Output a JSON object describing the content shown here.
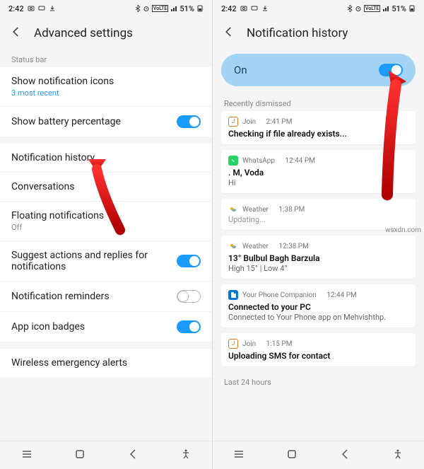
{
  "statusBar": {
    "time": "2:42",
    "battery": "51%",
    "netLabel": "VoLTE"
  },
  "left": {
    "title": "Advanced settings",
    "sectionStatusBar": "Status bar",
    "showNotifIcons": {
      "label": "Show notification icons",
      "sub": "3 most recent"
    },
    "showBattery": {
      "label": "Show battery percentage"
    },
    "notifHistory": "Notification history",
    "conversations": "Conversations",
    "floating": {
      "label": "Floating notifications",
      "sub": "Off"
    },
    "suggest": {
      "label": "Suggest actions and replies for notifications"
    },
    "reminders": "Notification reminders",
    "appIconBadges": "App icon badges",
    "wireless": "Wireless emergency alerts"
  },
  "right": {
    "title": "Notification history",
    "onLabel": "On",
    "recently": "Recently dismissed",
    "last24": "Last 24 hours",
    "items": [
      {
        "app": "Join",
        "time": "2:41 PM",
        "title": "Checking if file already exists...",
        "body": ""
      },
      {
        "app": "WhatsApp",
        "time": "12:44 PM",
        "title": ". M, Voda",
        "body": "Hi"
      },
      {
        "app": "Weather",
        "time": "1:38 PM",
        "title": "Updating...",
        "body": ""
      },
      {
        "app": "Weather",
        "time": "12:38 PM",
        "title": "13° Bulbul Bagh Barzula",
        "body": "High 15° | Low 4°"
      },
      {
        "app": "Your Phone Companion",
        "time": "12:44 PM",
        "title": "Connected to your PC",
        "body": "Connected to Your Phone app on Mehvishthp."
      },
      {
        "app": "Join",
        "time": "1:15 PM",
        "title": "Uploading SMS for contact",
        "body": ""
      }
    ]
  },
  "watermark": "wsxdn.com"
}
